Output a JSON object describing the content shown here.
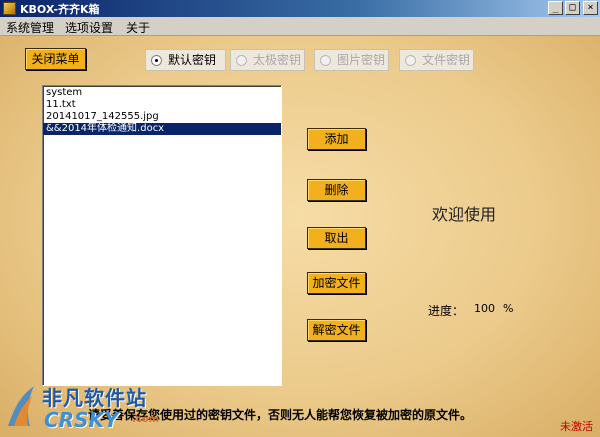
{
  "window": {
    "title": "KBOX-齐齐K箱",
    "controls": {
      "minimize": "_",
      "maximize": "□",
      "close": "×"
    }
  },
  "menubar": {
    "items": [
      "系统管理",
      "选项设置",
      "关于"
    ]
  },
  "main": {
    "close_menu_button": "关闭菜单",
    "key_options": [
      {
        "label": "默认密钥",
        "checked": true,
        "enabled": true
      },
      {
        "label": "太极密钥",
        "checked": false,
        "enabled": false
      },
      {
        "label": "图片密钥",
        "checked": false,
        "enabled": false
      },
      {
        "label": "文件密钥",
        "checked": false,
        "enabled": false
      }
    ],
    "file_list": [
      {
        "name": "system",
        "selected": false
      },
      {
        "name": "11.txt",
        "selected": false
      },
      {
        "name": "20141017_142555.jpg",
        "selected": false
      },
      {
        "name": "&&2014年体检通知.docx",
        "selected": true
      }
    ],
    "actions": {
      "add": "添加",
      "delete": "删除",
      "retrieve": "取出",
      "encrypt": "加密文件",
      "decrypt": "解密文件"
    },
    "welcome_text": "欢迎使用",
    "progress": {
      "label": "进度：",
      "value": "100",
      "unit": "%"
    },
    "notice": "请妥善保存您使用过的密钥文件，否则无人能帮您恢复被加密的原文件。",
    "status": "未激活"
  },
  "watermark": {
    "cn": "非凡软件站",
    "en": "CRSKY",
    "dotcom": ".com"
  },
  "colors": {
    "button_gold": "#f2b01e",
    "title_blue": "#0a246a",
    "status_red": "#c00000"
  }
}
